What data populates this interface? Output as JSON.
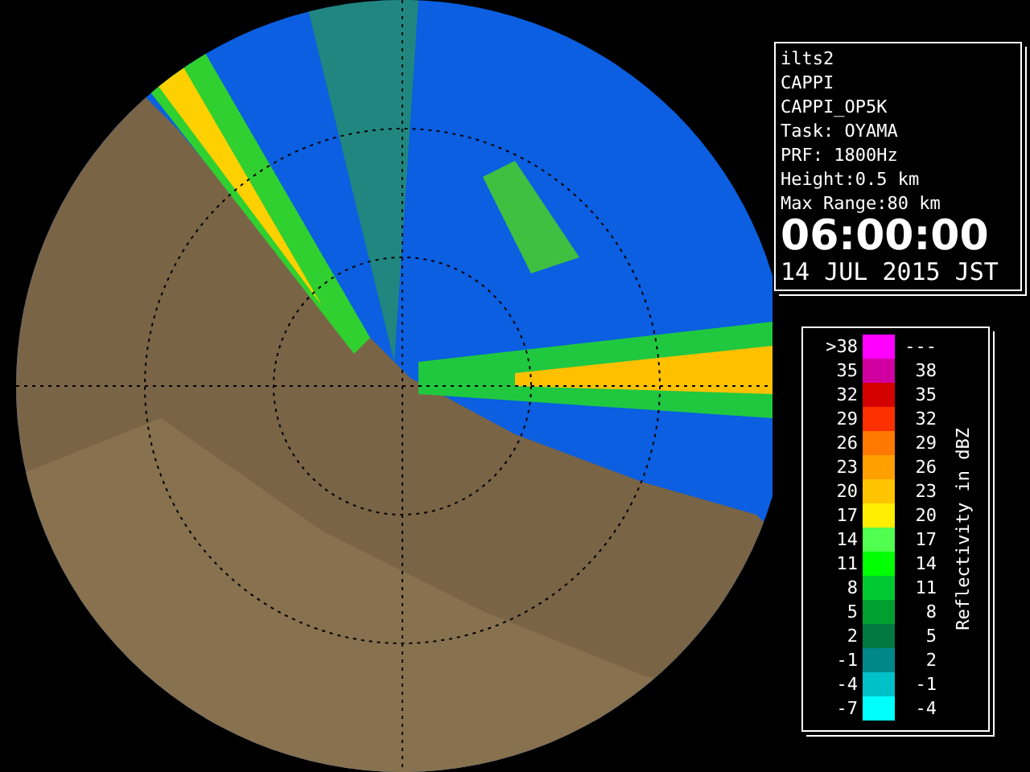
{
  "info": {
    "lines": [
      "ilts2",
      "CAPPI",
      "CAPPI_OP5K",
      "Task: OYAMA",
      "PRF: 1800Hz",
      "Height:0.5 km",
      "Max Range:80 km"
    ],
    "time": "06:00:00",
    "date": "14 JUL 2015 JST"
  },
  "legend": {
    "title": "Reflectivity in dBZ",
    "rows": [
      {
        "low": ">38",
        "high": "---",
        "color": "#ff00ff"
      },
      {
        "low": "35",
        "high": "38",
        "color": "#d000a0"
      },
      {
        "low": "32",
        "high": "35",
        "color": "#d40000"
      },
      {
        "low": "29",
        "high": "32",
        "color": "#ff3000"
      },
      {
        "low": "26",
        "high": "29",
        "color": "#ff7800"
      },
      {
        "low": "23",
        "high": "26",
        "color": "#ffa000"
      },
      {
        "low": "20",
        "high": "23",
        "color": "#ffc400"
      },
      {
        "low": "17",
        "high": "20",
        "color": "#ffee00"
      },
      {
        "low": "14",
        "high": "17",
        "color": "#50ff50"
      },
      {
        "low": "11",
        "high": "14",
        "color": "#00ff00"
      },
      {
        "low": "8",
        "high": "11",
        "color": "#00c830"
      },
      {
        "low": "5",
        "high": "8",
        "color": "#00a030"
      },
      {
        "low": "2",
        "high": "5",
        "color": "#007840"
      },
      {
        "low": "-1",
        "high": "2",
        "color": "#008888"
      },
      {
        "low": "-4",
        "high": "-1",
        "color": "#00c0c8"
      },
      {
        "low": "-7",
        "high": "-4",
        "color": "#00ffff"
      }
    ]
  }
}
